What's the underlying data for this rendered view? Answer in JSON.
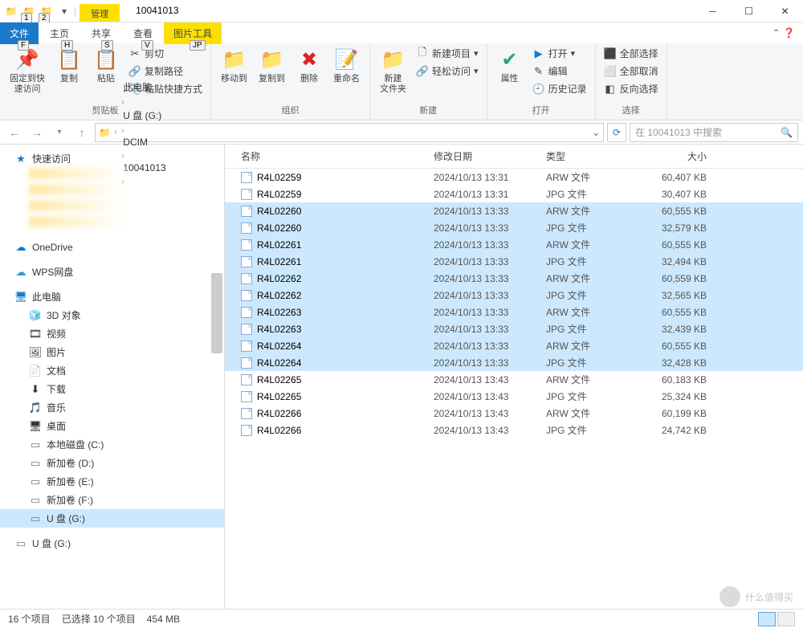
{
  "window": {
    "title": "10041013",
    "mgmt_tab": "管理",
    "qat_keys": [
      "1",
      "2"
    ]
  },
  "tabs": {
    "file": "文件",
    "file_key": "F",
    "home": "主页",
    "home_key": "H",
    "share": "共享",
    "share_key": "S",
    "view": "查看",
    "view_key": "V",
    "tools": "图片工具",
    "tools_key": "JP"
  },
  "ribbon": {
    "clipboard": {
      "pin": "固定到快\n速访问",
      "copy": "复制",
      "paste": "粘贴",
      "cut": "剪切",
      "copypath": "复制路径",
      "pasteshortcut": "粘贴快捷方式",
      "label": "剪贴板"
    },
    "organize": {
      "moveto": "移动到",
      "copyto": "复制到",
      "delete": "删除",
      "rename": "重命名",
      "label": "组织"
    },
    "new": {
      "newfolder": "新建\n文件夹",
      "newitem": "新建项目",
      "easyaccess": "轻松访问",
      "label": "新建"
    },
    "open": {
      "properties": "属性",
      "open_btn": "打开",
      "edit": "编辑",
      "history": "历史记录",
      "label": "打开"
    },
    "select": {
      "selectall": "全部选择",
      "selectnone": "全部取消",
      "invert": "反向选择",
      "label": "选择"
    }
  },
  "breadcrumb": {
    "items": [
      "此电脑",
      "U 盘 (G:)",
      "DCIM",
      "10041013"
    ]
  },
  "search": {
    "placeholder": "在 10041013 中搜索"
  },
  "sidebar": {
    "quick": "快速访问",
    "onedrive": "OneDrive",
    "wps": "WPS网盘",
    "thispc": "此电脑",
    "items": [
      {
        "label": "3D 对象",
        "icon": "🧊"
      },
      {
        "label": "视频",
        "icon": "🎞"
      },
      {
        "label": "图片",
        "icon": "🖼"
      },
      {
        "label": "文档",
        "icon": "📄"
      },
      {
        "label": "下载",
        "icon": "⬇"
      },
      {
        "label": "音乐",
        "icon": "🎵"
      },
      {
        "label": "桌面",
        "icon": "🖥"
      },
      {
        "label": "本地磁盘 (C:)",
        "icon": "drive"
      },
      {
        "label": "新加卷 (D:)",
        "icon": "drive"
      },
      {
        "label": "新加卷 (E:)",
        "icon": "drive"
      },
      {
        "label": "新加卷 (F:)",
        "icon": "drive"
      },
      {
        "label": "U 盘 (G:)",
        "icon": "drive",
        "selected": true
      }
    ],
    "external": "U 盘 (G:)"
  },
  "columns": {
    "name": "名称",
    "date": "修改日期",
    "type": "类型",
    "size": "大小"
  },
  "files": [
    {
      "name": "R4L02259",
      "date": "2024/10/13 13:31",
      "type": "ARW 文件",
      "size": "60,407 KB",
      "sel": false
    },
    {
      "name": "R4L02259",
      "date": "2024/10/13 13:31",
      "type": "JPG 文件",
      "size": "30,407 KB",
      "sel": false
    },
    {
      "name": "R4L02260",
      "date": "2024/10/13 13:33",
      "type": "ARW 文件",
      "size": "60,555 KB",
      "sel": true
    },
    {
      "name": "R4L02260",
      "date": "2024/10/13 13:33",
      "type": "JPG 文件",
      "size": "32,579 KB",
      "sel": true
    },
    {
      "name": "R4L02261",
      "date": "2024/10/13 13:33",
      "type": "ARW 文件",
      "size": "60,555 KB",
      "sel": true
    },
    {
      "name": "R4L02261",
      "date": "2024/10/13 13:33",
      "type": "JPG 文件",
      "size": "32,494 KB",
      "sel": true
    },
    {
      "name": "R4L02262",
      "date": "2024/10/13 13:33",
      "type": "ARW 文件",
      "size": "60,559 KB",
      "sel": true
    },
    {
      "name": "R4L02262",
      "date": "2024/10/13 13:33",
      "type": "JPG 文件",
      "size": "32,565 KB",
      "sel": true
    },
    {
      "name": "R4L02263",
      "date": "2024/10/13 13:33",
      "type": "ARW 文件",
      "size": "60,555 KB",
      "sel": true
    },
    {
      "name": "R4L02263",
      "date": "2024/10/13 13:33",
      "type": "JPG 文件",
      "size": "32,439 KB",
      "sel": true
    },
    {
      "name": "R4L02264",
      "date": "2024/10/13 13:33",
      "type": "ARW 文件",
      "size": "60,555 KB",
      "sel": true
    },
    {
      "name": "R4L02264",
      "date": "2024/10/13 13:33",
      "type": "JPG 文件",
      "size": "32,428 KB",
      "sel": true
    },
    {
      "name": "R4L02265",
      "date": "2024/10/13 13:43",
      "type": "ARW 文件",
      "size": "60,183 KB",
      "sel": false
    },
    {
      "name": "R4L02265",
      "date": "2024/10/13 13:43",
      "type": "JPG 文件",
      "size": "25,324 KB",
      "sel": false
    },
    {
      "name": "R4L02266",
      "date": "2024/10/13 13:43",
      "type": "ARW 文件",
      "size": "60,199 KB",
      "sel": false
    },
    {
      "name": "R4L02266",
      "date": "2024/10/13 13:43",
      "type": "JPG 文件",
      "size": "24,742 KB",
      "sel": false
    }
  ],
  "status": {
    "count": "16 个项目",
    "selected": "已选择 10 个项目",
    "size": "454 MB"
  },
  "watermark": "什么值得买"
}
